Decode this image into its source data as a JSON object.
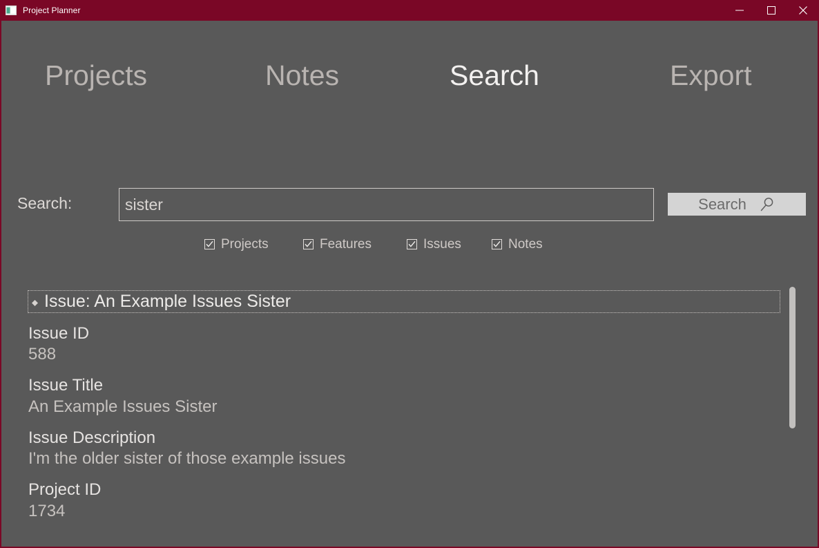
{
  "window": {
    "title": "Project Planner",
    "icon": "app-window-icon",
    "accent_color": "#7a0726",
    "background_color": "#595959",
    "controls": {
      "minimize": "minimize-icon",
      "maximize": "maximize-icon",
      "close": "close-icon"
    }
  },
  "nav": {
    "tabs": [
      {
        "label": "Projects",
        "active": false
      },
      {
        "label": "Notes",
        "active": false
      },
      {
        "label": "Search",
        "active": true
      },
      {
        "label": "Export",
        "active": false
      }
    ]
  },
  "search": {
    "label": "Search:",
    "value": "sister",
    "placeholder": "",
    "button_label": "Search",
    "button_icon": "magnifier-icon"
  },
  "filters": [
    {
      "label": "Projects",
      "checked": true
    },
    {
      "label": "Features",
      "checked": true
    },
    {
      "label": "Issues",
      "checked": true
    },
    {
      "label": "Notes",
      "checked": true
    }
  ],
  "results": {
    "header": "Issue: An Example Issues Sister",
    "header_bullet": "diamond-bullet-icon",
    "fields": [
      {
        "label": "Issue ID",
        "value": "588"
      },
      {
        "label": "Issue Title",
        "value": "An Example Issues Sister"
      },
      {
        "label": "Issue Description",
        "value": "I'm the older sister of those example issues"
      },
      {
        "label": "Project ID",
        "value": "1734"
      }
    ]
  }
}
